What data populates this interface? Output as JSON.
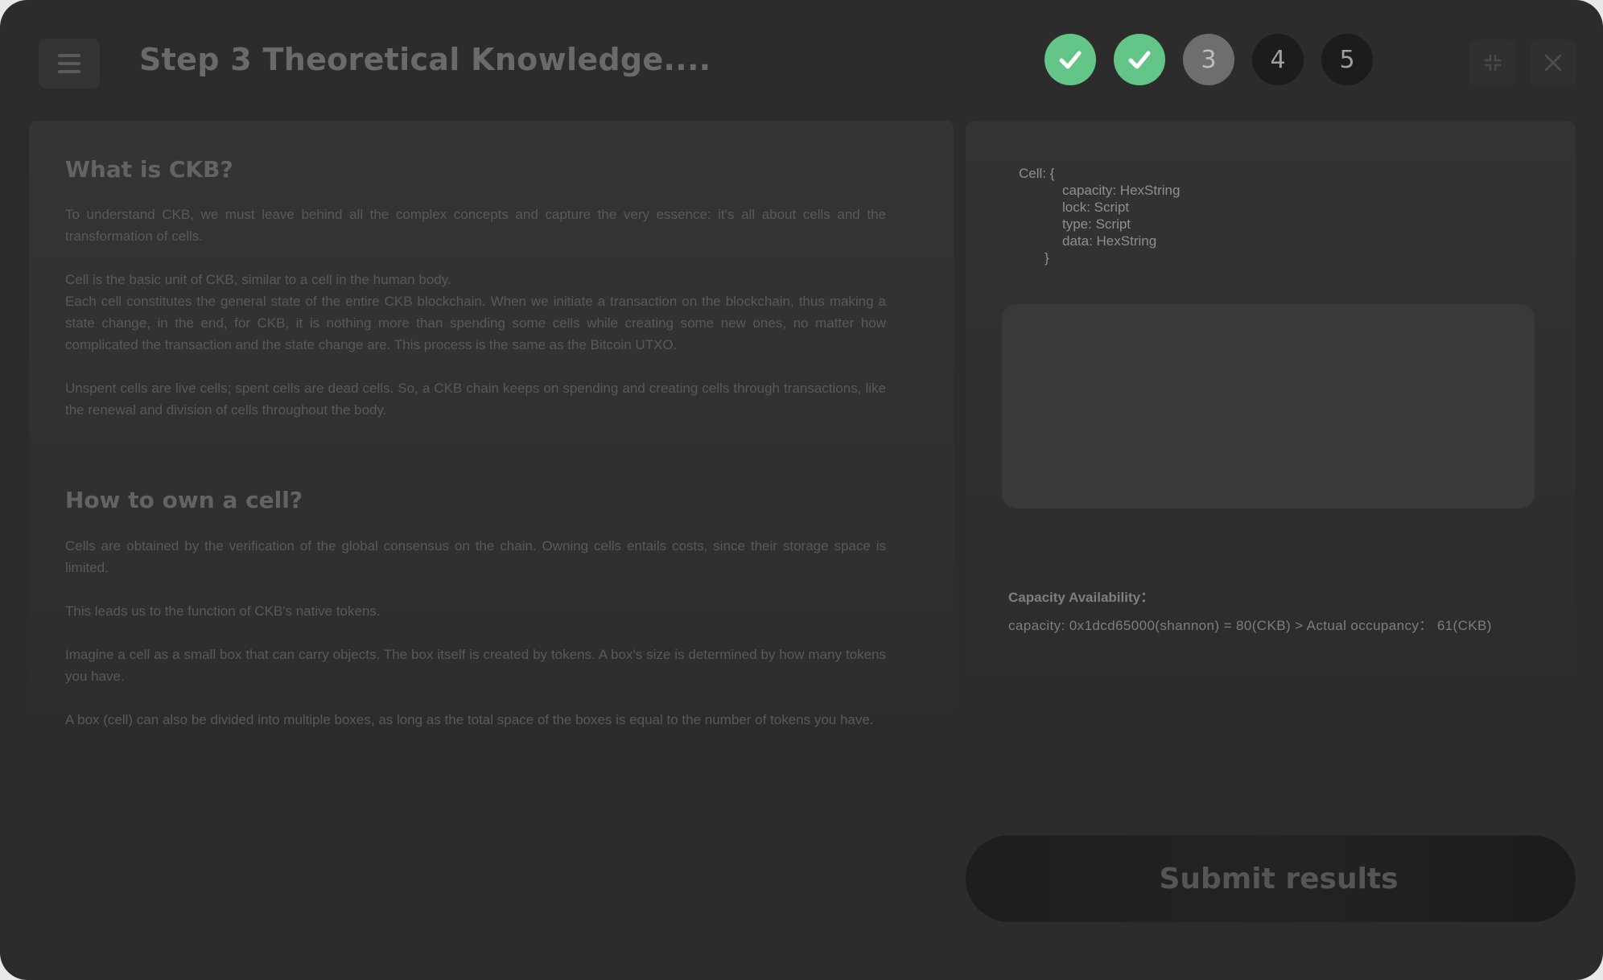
{
  "header": {
    "title": "Step 3 Theoretical Knowledge....",
    "steps": [
      {
        "label": "",
        "status": "done",
        "icon": "check-icon"
      },
      {
        "label": "",
        "status": "done",
        "icon": "check-icon"
      },
      {
        "label": "3",
        "status": "current"
      },
      {
        "label": "4",
        "status": "todo"
      },
      {
        "label": "5",
        "status": "todo"
      }
    ],
    "icons": {
      "menu": "menu-icon",
      "minimize": "collapse-icon",
      "close": "close-icon"
    }
  },
  "content": {
    "section1": {
      "heading": "What is CKB?",
      "paragraphs": [
        "To understand CKB, we must leave behind all the complex concepts and capture the very essence: it's all about cells and the transformation of cells.",
        "Cell is the basic unit of CKB, similar to a cell in the human body.",
        "Each cell constitutes the general state of the entire CKB blockchain. When we initiate a transaction on the blockchain, thus making a state change, in the end, for CKB, it is nothing more than spending some cells while creating some new ones, no matter how complicated the transaction and the state change are. This process is the same as the Bitcoin UTXO.",
        "Unspent cells are live cells; spent cells are dead cells. So, a CKB chain keeps on spending and creating cells through transactions, like the renewal and division of cells throughout the body."
      ]
    },
    "section2": {
      "heading": "How to own a cell?",
      "paragraphs": [
        "Cells are obtained by the verification of the global consensus on the chain. Owning cells entails costs, since their storage space is limited.",
        "This leads us to the function of CKB's native tokens.",
        "Imagine a cell as a small box that can carry objects. The box itself is created by tokens. A box's size is determined by how many tokens you have.",
        "A box (cell) can also be divided into multiple boxes, as long as the total space of the boxes is equal to the number of tokens you have."
      ]
    }
  },
  "code": {
    "lines": [
      "Cell: {",
      "capacity: HexString",
      "lock: Script",
      "type: Script",
      "data: HexString",
      "}"
    ]
  },
  "capacity": {
    "label": "Capacity Availability：",
    "value": "capacity: 0x1dcd65000(shannon) = 80(CKB) > Actual occupancy： 61(CKB)"
  },
  "submit_label": "Submit results",
  "colors": {
    "done": "#63c587",
    "current": "#6e6e6e",
    "todo": "#1c1c1c"
  }
}
